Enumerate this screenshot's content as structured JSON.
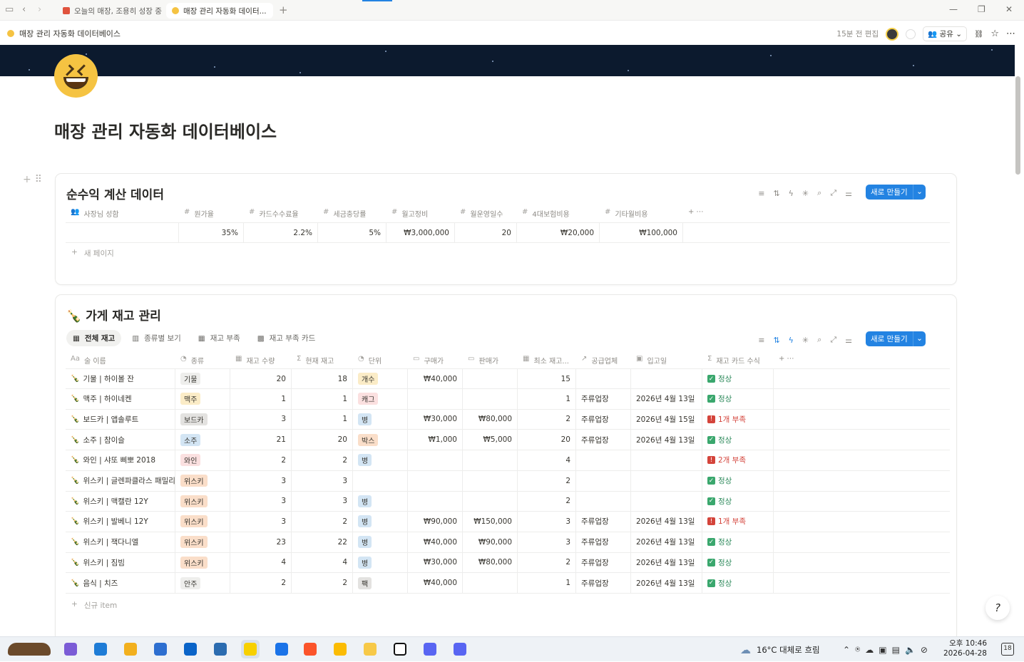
{
  "browser": {
    "tabs": [
      {
        "title": "오늘의 매장, 조용히 성장 중",
        "active": false,
        "fav_color": "#e0533d"
      },
      {
        "title": "매장 관리 자동화 데이터...",
        "active": true,
        "fav_color": "#f5c342"
      }
    ],
    "new_tab": "+",
    "window_controls": {
      "minimize": "—",
      "restore": "❐",
      "close": "✕"
    }
  },
  "topbar": {
    "breadcrumb": "매장 관리 자동화 데이터베이스",
    "edited": "15분 전 편집",
    "share": "공유"
  },
  "page": {
    "title": "매장 관리 자동화 데이터베이스"
  },
  "db1": {
    "title": "순수익 계산 데이터",
    "new_button": "새로 만들기",
    "columns": [
      {
        "icon": "people",
        "label": "사장님 성함"
      },
      {
        "icon": "#",
        "label": "원가율"
      },
      {
        "icon": "#",
        "label": "카드수수료율"
      },
      {
        "icon": "#",
        "label": "세금충당률"
      },
      {
        "icon": "#",
        "label": "월고정비"
      },
      {
        "icon": "#",
        "label": "월운영일수"
      },
      {
        "icon": "#",
        "label": "4대보험비용"
      },
      {
        "icon": "#",
        "label": "기타월비용"
      }
    ],
    "rows": [
      [
        "",
        "35%",
        "2.2%",
        "5%",
        "₩3,000,000",
        "20",
        "₩20,000",
        "₩100,000"
      ]
    ],
    "add_row": "새 페이지"
  },
  "db2": {
    "title": "가게 재고 관리",
    "views": [
      "전체 재고",
      "종류별 보기",
      "재고 부족",
      "재고 부족 카드"
    ],
    "active_view": 0,
    "new_button": "새로 만들기",
    "columns": [
      {
        "icon": "Aa",
        "label": "술 이름"
      },
      {
        "icon": "select",
        "label": "종류"
      },
      {
        "icon": "number",
        "label": "재고 수량"
      },
      {
        "icon": "Σ",
        "label": "현재 재고"
      },
      {
        "icon": "select",
        "label": "단위"
      },
      {
        "icon": "money",
        "label": "구매가"
      },
      {
        "icon": "money",
        "label": "판매가"
      },
      {
        "icon": "number",
        "label": "최소 재고..."
      },
      {
        "icon": "relation",
        "label": "공급업체"
      },
      {
        "icon": "date",
        "label": "입고일"
      },
      {
        "icon": "Σ",
        "label": "재고 카드 수식"
      }
    ],
    "rows": [
      {
        "name": "기물 | 하이볼 잔",
        "type": "기물",
        "qty": "20",
        "current": "18",
        "unit": "개수",
        "buy": "₩40,000",
        "sell": "",
        "min": "15",
        "supplier": "",
        "date": "",
        "status": "정상",
        "ok": true
      },
      {
        "name": "맥주 | 하이네켄",
        "type": "맥주",
        "qty": "1",
        "current": "1",
        "unit": "캐그",
        "buy": "",
        "sell": "",
        "min": "1",
        "supplier": "주류업장",
        "date": "2026년 4월 13일",
        "status": "정상",
        "ok": true
      },
      {
        "name": "보드카 | 앱솔루트",
        "type": "보드카",
        "qty": "3",
        "current": "1",
        "unit": "병",
        "buy": "₩30,000",
        "sell": "₩80,000",
        "min": "2",
        "supplier": "주류업장",
        "date": "2026년 4월 15일",
        "status": "1개 부족",
        "ok": false
      },
      {
        "name": "소주 | 참이슬",
        "type": "소주",
        "qty": "21",
        "current": "20",
        "unit": "박스",
        "buy": "₩1,000",
        "sell": "₩5,000",
        "min": "20",
        "supplier": "주류업장",
        "date": "2026년 4월 13일",
        "status": "정상",
        "ok": true
      },
      {
        "name": "와인 | 샤또 삐뽀 2018",
        "type": "와인",
        "qty": "2",
        "current": "2",
        "unit": "병",
        "buy": "",
        "sell": "",
        "min": "4",
        "supplier": "",
        "date": "",
        "status": "2개 부족",
        "ok": false
      },
      {
        "name": "위스키 | 글렌파클라스 패밀리",
        "type": "위스키",
        "qty": "3",
        "current": "3",
        "unit": "",
        "buy": "",
        "sell": "",
        "min": "2",
        "supplier": "",
        "date": "",
        "status": "정상",
        "ok": true
      },
      {
        "name": "위스키 | 맥캘란 12Y",
        "type": "위스키",
        "qty": "3",
        "current": "3",
        "unit": "병",
        "buy": "",
        "sell": "",
        "min": "2",
        "supplier": "",
        "date": "",
        "status": "정상",
        "ok": true
      },
      {
        "name": "위스키 | 발베니 12Y",
        "type": "위스키",
        "qty": "3",
        "current": "2",
        "unit": "병",
        "buy": "₩90,000",
        "sell": "₩150,000",
        "min": "3",
        "supplier": "주류업장",
        "date": "2026년 4월 13일",
        "status": "1개 부족",
        "ok": false
      },
      {
        "name": "위스키 | 잭다니엘",
        "type": "위스키",
        "qty": "23",
        "current": "22",
        "unit": "병",
        "buy": "₩40,000",
        "sell": "₩90,000",
        "min": "3",
        "supplier": "주류업장",
        "date": "2026년 4월 13일",
        "status": "정상",
        "ok": true
      },
      {
        "name": "위스키 | 짐빔",
        "type": "위스키",
        "qty": "4",
        "current": "4",
        "unit": "병",
        "buy": "₩30,000",
        "sell": "₩80,000",
        "min": "2",
        "supplier": "주류업장",
        "date": "2026년 4월 13일",
        "status": "정상",
        "ok": true
      },
      {
        "name": "음식 | 치즈",
        "type": "안주",
        "qty": "2",
        "current": "2",
        "unit": "팩",
        "buy": "₩40,000",
        "sell": "",
        "min": "1",
        "supplier": "주류업장",
        "date": "2026년 4월 13일",
        "status": "정상",
        "ok": true
      }
    ],
    "add_row": "신규 item"
  },
  "tag_colors": {
    "기물": "#eeeeec",
    "맥주": "#fbecc7",
    "보드카": "#e3e2e0",
    "소주": "#d3e5f4",
    "와인": "#fbe0e0",
    "위스키": "#fadec9",
    "안주": "#eeeeec",
    "개수": "#fbecc7",
    "캐그": "#fbe0e0",
    "병": "#d3e5f4",
    "박스": "#fadec9",
    "팩": "#e3e2e0"
  },
  "taskbar": {
    "apps": [
      "kakao-talk",
      "copilot",
      "edge",
      "file-explorer",
      "store",
      "outlook",
      "widgets",
      "kakaotalk",
      "outlook-new",
      "brave",
      "keep",
      "sticky-notes",
      "notion",
      "chat",
      "discord"
    ],
    "weather": "16°C  대체로 흐림",
    "time": "오후 10:46",
    "date": "2026-04-28",
    "notif_count": "18"
  }
}
